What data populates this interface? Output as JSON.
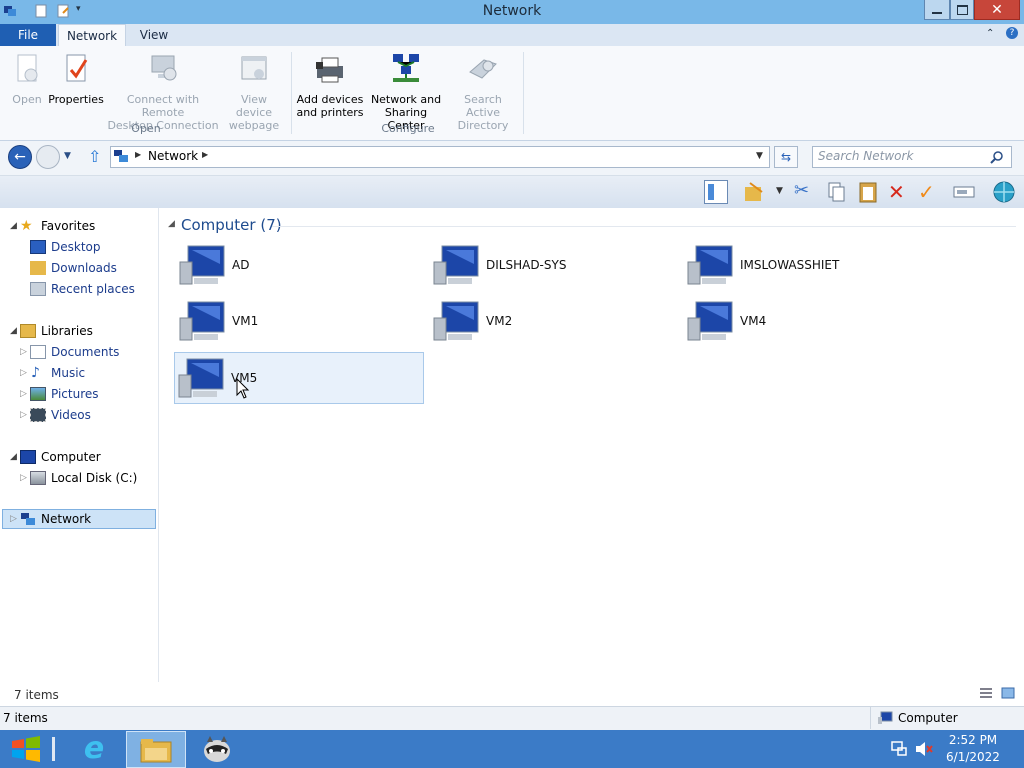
{
  "window": {
    "title": "Network"
  },
  "ribbon": {
    "tabs": [
      "File",
      "Network",
      "View"
    ],
    "open_group": {
      "label": "Open",
      "buttons": [
        {
          "label": "Open"
        },
        {
          "label": "Properties"
        },
        {
          "label_line1": "Connect with Remote",
          "label_line2": "Desktop Connection"
        },
        {
          "label_line1": "View device",
          "label_line2": "webpage"
        }
      ]
    },
    "configure_group": {
      "label": "Configure",
      "buttons": [
        {
          "label_line1": "Add devices",
          "label_line2": "and printers"
        },
        {
          "label_line1": "Network and",
          "label_line2": "Sharing Center"
        },
        {
          "label_line1": "Search Active",
          "label_line2": "Directory"
        }
      ]
    }
  },
  "address": {
    "path": "Network"
  },
  "search": {
    "placeholder": "Search Network"
  },
  "nav": {
    "favorites": {
      "label": "Favorites",
      "items": [
        "Desktop",
        "Downloads",
        "Recent places"
      ]
    },
    "libraries": {
      "label": "Libraries",
      "items": [
        "Documents",
        "Music",
        "Pictures",
        "Videos"
      ]
    },
    "computer": {
      "label": "Computer",
      "items": [
        "Local Disk (C:)"
      ]
    },
    "network": {
      "label": "Network"
    }
  },
  "content": {
    "group_header": "Computer (7)",
    "computers": [
      "AD",
      "DILSHAD-SYS",
      "IMSLOWASSHIET",
      "VM1",
      "VM2",
      "VM4",
      "VM5"
    ]
  },
  "status": {
    "item_count": "7 items",
    "bottom_count": "7 items",
    "bottom_location": "Computer"
  },
  "taskbar": {
    "time": "2:52 PM",
    "date": "6/1/2022"
  },
  "colors": {
    "accent": "#1f5fb3",
    "titlebar": "#79b8e8",
    "taskbar": "#3b7bc7",
    "selection": "#cde3f7"
  }
}
